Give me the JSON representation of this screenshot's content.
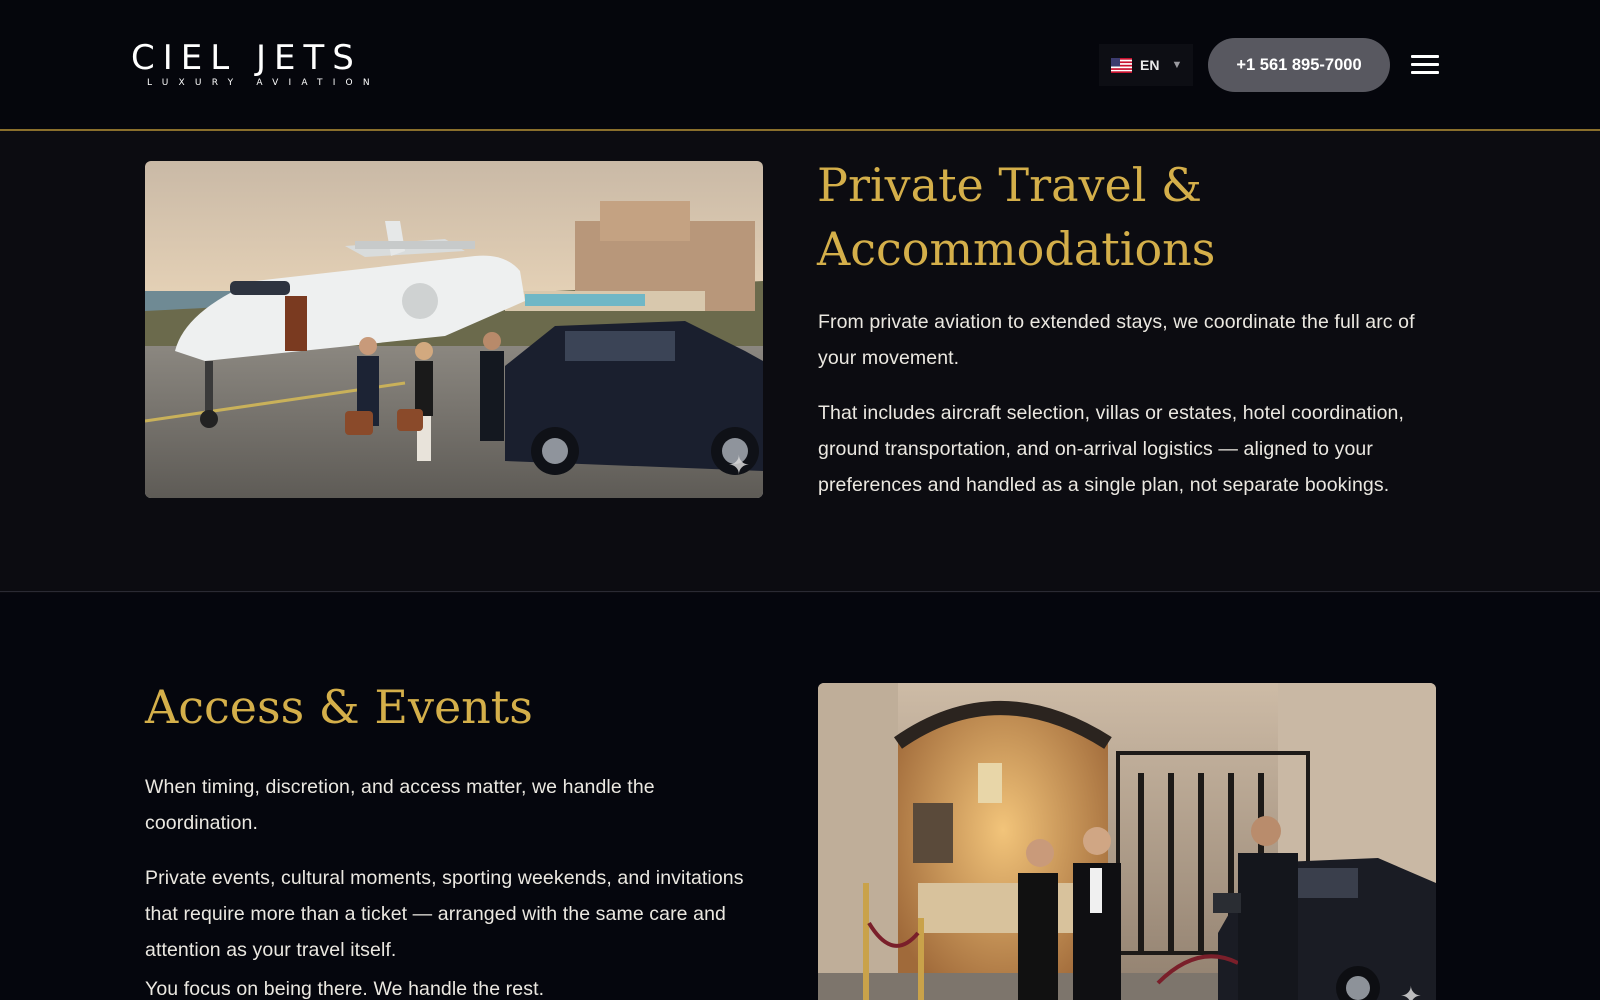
{
  "header": {
    "logo_main": "CIEL JETS",
    "logo_sub": "LUXURY AVIATION",
    "language": "EN",
    "phone": "+1 561 895-7000",
    "menu_icon": "hamburger-menu-icon",
    "flag_icon": "us-flag-icon"
  },
  "travel": {
    "title": "Private Travel & Accommodations",
    "paragraphs": [
      "From private aviation to extended stays, we coordinate the full arc of your movement.",
      "That includes aircraft selection, villas or estates, hotel coordination, ground transportation, and on-arrival logistics — aligned to your preferences and handled as a single plan, not separate bookings."
    ]
  },
  "events": {
    "title": "Access & Events",
    "paragraphs": [
      "When timing, discretion, and access matter, we handle the coordination.",
      "Private events, cultural moments, sporting weekends, and invitations that require more than a ticket — arranged with the same care and attention as your travel itself.",
      "You focus on being there. We handle the rest."
    ]
  },
  "colors": {
    "accent_gold": "#d4af4a",
    "header_bg": "#05060c",
    "phone_button_bg": "#585860"
  }
}
